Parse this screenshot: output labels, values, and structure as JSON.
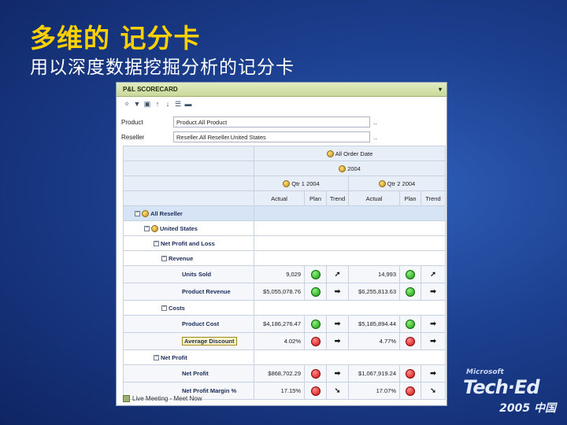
{
  "slide": {
    "title": "多维的 记分卡",
    "subtitle": "用以深度数据挖掘分析的记分卡"
  },
  "panel": {
    "title": "P&L SCORECARD",
    "menu_glyph": "▾",
    "filters": [
      {
        "label": "Product",
        "value": "Product.All Product",
        "more": ".."
      },
      {
        "label": "Reseller",
        "value": "Reseller.All Reseller.United States",
        "more": ".."
      }
    ],
    "columns": {
      "all_order_date": "All Order Date",
      "year": "2004",
      "qtr1": "Qtr 1 2004",
      "qtr2": "Qtr 2 2004",
      "actual": "Actual",
      "plan": "Plan",
      "trend": "Trend"
    },
    "hierarchy": {
      "all_reseller": "All Reseller",
      "united_states": "United States",
      "net_profit_and_loss": "Net Profit and Loss",
      "revenue": "Revenue",
      "costs": "Costs",
      "net_profit": "Net Profit"
    },
    "rows": [
      {
        "name": "Units Sold",
        "q1_actual": "9,029",
        "q1_plan": "green",
        "q1_trend": "➚",
        "q2_actual": "14,993",
        "q2_plan": "green",
        "q2_trend": "➚"
      },
      {
        "name": "Product Revenue",
        "q1_actual": "$5,055,078.76",
        "q1_plan": "green",
        "q1_trend": "➡",
        "q2_actual": "$6,255,813.63",
        "q2_plan": "green",
        "q2_trend": "➡"
      },
      {
        "name": "Product Cost",
        "q1_actual": "$4,186,276.47",
        "q1_plan": "green",
        "q1_trend": "➡",
        "q2_actual": "$5,185,894.44",
        "q2_plan": "green",
        "q2_trend": "➡"
      },
      {
        "name": "Average Discount",
        "q1_actual": "4.02%",
        "q1_plan": "red",
        "q1_trend": "➡",
        "q2_actual": "4.77%",
        "q2_plan": "red",
        "q2_trend": "➡"
      },
      {
        "name": "Net Profit",
        "q1_actual": "$868,702.29",
        "q1_plan": "red",
        "q1_trend": "➡",
        "q2_actual": "$1,067,919.24",
        "q2_plan": "red",
        "q2_trend": "➡"
      },
      {
        "name": "Net Profit Margin %",
        "q1_actual": "17.15%",
        "q1_plan": "red",
        "q1_trend": "➘",
        "q2_actual": "17.07%",
        "q2_plan": "red",
        "q2_trend": "➘"
      }
    ],
    "footer": "Live Meeting - Meet Now"
  },
  "logo": {
    "brand": "Microsoft",
    "event": "Tech·Ed",
    "year": "2005 中国"
  },
  "colors": {
    "title": "#ffd100",
    "plan_good": "#1d9a12",
    "plan_bad": "#d01010",
    "header_bar": "#c9d99a"
  }
}
